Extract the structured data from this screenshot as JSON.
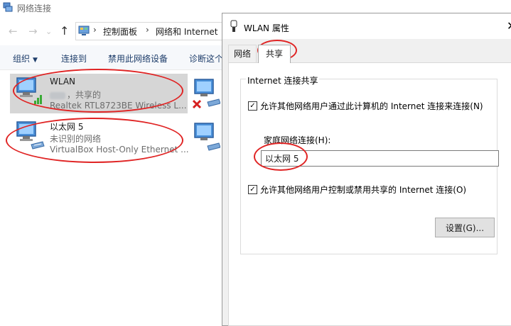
{
  "explorer": {
    "title": "网络连接",
    "breadcrumb": [
      "控制面板",
      "网络和 Internet"
    ],
    "commands": [
      "组织",
      "连接到",
      "禁用此网络设备",
      "诊断这个"
    ],
    "connections": [
      {
        "name": "WLAN",
        "status": "，共享的",
        "device": "Realtek RTL8723BE Wireless L..."
      },
      {
        "name": "以太网 5",
        "status": "未识别的网络",
        "device": "VirtualBox Host-Only Ethernet ..."
      }
    ]
  },
  "dialog": {
    "title": "WLAN 属性",
    "tabs": [
      "网络",
      "共享"
    ],
    "active_tab": "共享",
    "group_label": "Internet 连接共享",
    "allow_share_label": "允许其他网络用户通过此计算机的 Internet 连接来连接(N)",
    "allow_share_checked": true,
    "home_network_label": "家庭网络连接(H):",
    "home_network_value": "以太网 5",
    "allow_control_label": "允许其他网络用户控制或禁用共享的 Internet 连接(O)",
    "allow_control_checked": true,
    "settings_button": "设置(G)..."
  },
  "colors": {
    "annotation": "#e02424",
    "selection": "#d6d6d6",
    "command_text": "#1f3e6b"
  }
}
